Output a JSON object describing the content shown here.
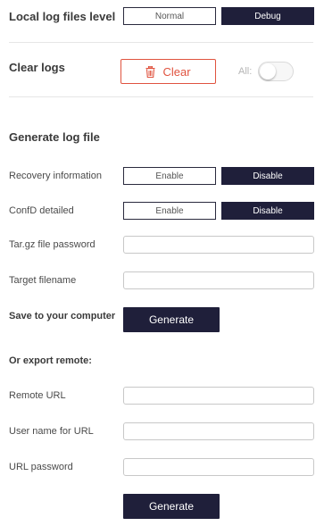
{
  "log_level": {
    "label": "Local log files level",
    "options": [
      "Normal",
      "Debug"
    ],
    "selected": "Debug"
  },
  "clear_logs": {
    "label": "Clear logs",
    "button_label": "Clear",
    "all_label": "All:",
    "all_enabled": false
  },
  "generate": {
    "heading": "Generate log file",
    "recovery": {
      "label": "Recovery information",
      "enable": "Enable",
      "disable": "Disable",
      "selected": "Disable"
    },
    "confd": {
      "label": "ConfD detailed",
      "enable": "Enable",
      "disable": "Disable",
      "selected": "Disable"
    },
    "password_label": "Tar.gz file password",
    "password_value": "",
    "filename_label": "Target filename",
    "filename_value": "",
    "save_label": "Save to your computer",
    "generate_button": "Generate"
  },
  "export_remote": {
    "heading": "Or export remote:",
    "url_label": "Remote URL",
    "url_value": "",
    "user_label": "User name for URL",
    "user_value": "",
    "pass_label": "URL password",
    "pass_value": "",
    "generate_button": "Generate"
  },
  "colors": {
    "primary": "#1f1f3a",
    "danger": "#e0533f"
  },
  "icons": {
    "clear": "trash-icon"
  }
}
